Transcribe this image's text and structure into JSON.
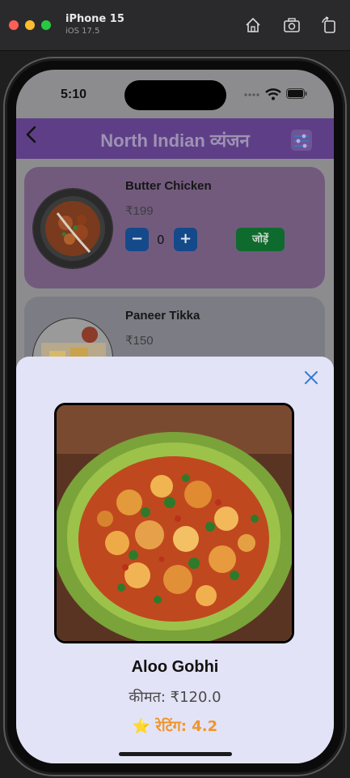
{
  "simulator": {
    "device": "iPhone 15",
    "os": "iOS 17.5",
    "icons": [
      "home-icon",
      "screenshot-icon",
      "rotate-icon"
    ]
  },
  "status_bar": {
    "time": "5:10"
  },
  "nav": {
    "title": "North Indian व्यंजन",
    "back_icon": "chevron-left-icon",
    "filter_icon": "filter-icon",
    "bar_color": "#5e3f87"
  },
  "menu": {
    "items": [
      {
        "name": "Butter Chicken",
        "price": "₹199",
        "qty": "0",
        "minus": "−",
        "plus": "+",
        "add_label": "जोड़ें"
      },
      {
        "name": "Paneer Tikka",
        "price": "₹150"
      }
    ]
  },
  "detail": {
    "name": "Aloo Gobhi",
    "price": "कीमत: ₹120.0",
    "rating_star": "⭐",
    "rating": "रेटिंग: 4.2",
    "close_icon": "close-icon",
    "rating_color": "#f0952a",
    "sheet_color": "#e3e3f7"
  }
}
